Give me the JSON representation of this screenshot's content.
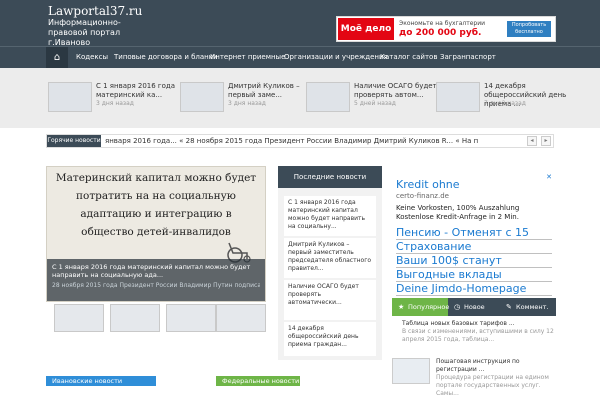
{
  "site": {
    "title": "Lawportal37.ru",
    "subtitle": "Информационно-правовой портал г.Иваново"
  },
  "banner": {
    "logo": "Моё дело",
    "text": "Экономьте на бухгалтерии",
    "amount": "до 200 000 руб.",
    "button": "Попробовать бесплатно"
  },
  "nav": {
    "home_icon": "home-icon",
    "items": [
      "Кодексы",
      "Типовые договора и бланки",
      "Интернет приемные",
      "Организации и учреждения",
      "Каталог сайтов",
      "Загранпаспорт"
    ]
  },
  "featured": [
    {
      "title": "С 1 января 2016 года материнский ка...",
      "date": "3 дня назад"
    },
    {
      "title": "Дмитрий Куликов – первый заме...",
      "date": "3 дня назад"
    },
    {
      "title": "Наличие ОСАГО будет проверять автом...",
      "date": "5 дней назад"
    },
    {
      "title": "14 декабря общероссийский день приема ...",
      "date": "7 дней назад"
    }
  ],
  "ticker": {
    "label": "Горячие новости",
    "text": "января 2016 года... « 28 ноября 2015 года Президент России Владимир Дмитрий Куликов R... « На п",
    "prev": "◂",
    "next": "▸"
  },
  "slide": {
    "image_text": "Материнский капитал можно будет потратить на на социальную адаптацию и интеграцию в общество детей-инвалидов",
    "caption": "С 1 января 2016 года материнский капитал можно будет направить на социальную ада...",
    "caption_sub": "28 ноября 2015 года Президент России Владимир Путин подписал закон № 348-ФЗ «О..."
  },
  "last_news": {
    "heading": "Последние новости",
    "items": [
      "С 1 января 2016 года материнский капитал можно будет направить на социальну...",
      "Дмитрий Куликов – первый заместитель председателя областного правител...",
      "Наличие ОСАГО будет проверять автоматически...",
      "14 декабря общероссийский день приема граждан..."
    ]
  },
  "ad": {
    "title": "Kredit ohne",
    "url": "certo-finanz.de",
    "desc": "Keine Vorkosten, 100% Auszahlung Kostenlose Kredit-Anfrage in 2 Min.",
    "links": [
      "Пенсию - Отменят с 15",
      "Страхование",
      "Ваши 100$ станут",
      "Выгодные вклады",
      "Deine Jimdo-Homepage"
    ],
    "close": "✕"
  },
  "tabs": [
    {
      "label": "Популярное",
      "icon": "star-icon"
    },
    {
      "label": "Новое",
      "icon": "clock-icon"
    },
    {
      "label": "Коммент.",
      "icon": "comment-icon"
    }
  ],
  "side_items": [
    {
      "title": "Таблица новых базовых тарифов ...",
      "text": "В связи с изменениями, вступившими в силу 12 апреля 2015 года, таблица..."
    },
    {
      "title": "Пошаговая инструкция по регистрации ...",
      "text": "Процедура регистрации на едином портале государственных услуг. Самы..."
    }
  ],
  "categories": [
    {
      "label": "Ивановские новости",
      "color": "#2f8ed8"
    },
    {
      "label": "Федеральные новости",
      "color": "#6eb547"
    }
  ],
  "colors": {
    "header": "#3c4b57",
    "accent_green": "#6eb547",
    "accent_blue": "#2f8ed8",
    "link_blue": "#1a7ad0"
  }
}
